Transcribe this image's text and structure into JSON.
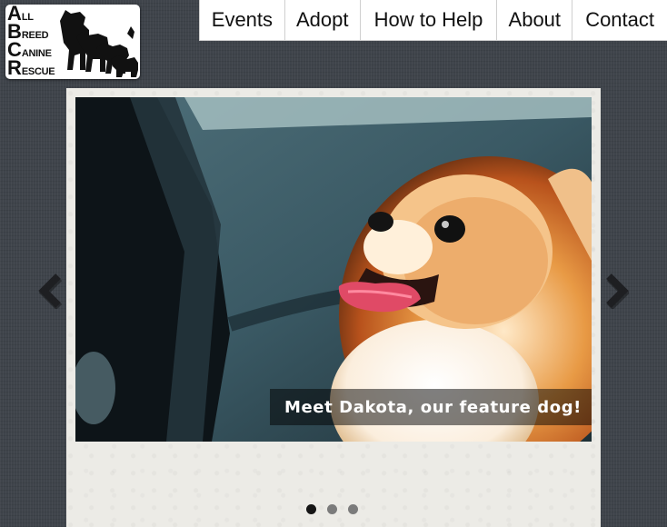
{
  "logo": {
    "lines": [
      {
        "initial": "A",
        "rest": "LL"
      },
      {
        "initial": "B",
        "rest": "REED"
      },
      {
        "initial": "C",
        "rest": "ANINE"
      },
      {
        "initial": "R",
        "rest": "ESCUE"
      }
    ]
  },
  "nav": {
    "items": [
      {
        "label": "Events"
      },
      {
        "label": "Adopt"
      },
      {
        "label": "How to Help"
      },
      {
        "label": "About"
      },
      {
        "label": "Contact"
      }
    ]
  },
  "slider": {
    "caption": "Meet Dakota, our feature dog!",
    "prev_icon": "chevron-left-icon",
    "next_icon": "chevron-right-icon",
    "slide_count": 3,
    "active_index": 0
  },
  "colors": {
    "background": "#3f444b",
    "frame": "#ecebe6",
    "nav_background": "#ffffff",
    "dot_active": "#151515",
    "dot_inactive": "#7b7b7b"
  }
}
